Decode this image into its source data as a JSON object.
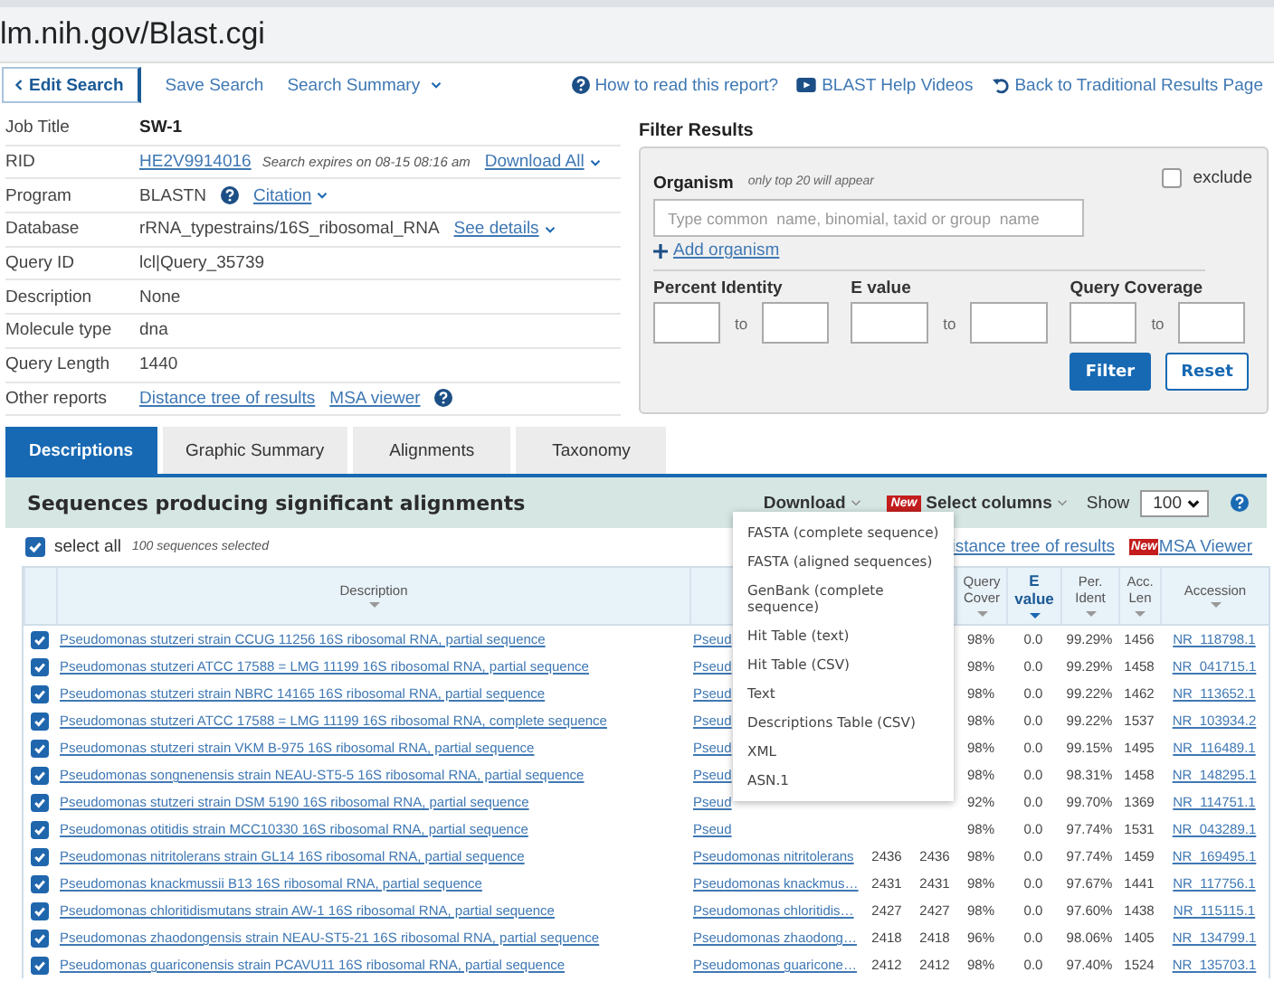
{
  "address_bar": {
    "url": "lm.nih.gov/Blast.cgi"
  },
  "nav": {
    "edit_search": "Edit Search",
    "links": [
      {
        "label": "Save Search",
        "menu": false
      },
      {
        "label": "Search Summary",
        "menu": true
      }
    ],
    "help_links": [
      {
        "kind": "help",
        "label": "How to read this report?"
      },
      {
        "kind": "video",
        "label": "BLAST Help Videos"
      },
      {
        "kind": "back",
        "label": "Back to Traditional Results Page"
      }
    ]
  },
  "info": [
    {
      "label": "Job Title",
      "parts": [
        {
          "kind": "bold",
          "text": "SW-1"
        }
      ]
    },
    {
      "label": "RID",
      "parts": [
        {
          "kind": "link",
          "text": "HE2V9914016",
          "menu": false
        },
        {
          "kind": "note",
          "text": "Search expires on 08-15 08:16 am"
        },
        {
          "kind": "link",
          "text": "Download All",
          "menu": true
        }
      ]
    },
    {
      "label": "Program",
      "parts": [
        {
          "kind": "text",
          "text": "BLASTN"
        },
        {
          "kind": "help"
        },
        {
          "kind": "link",
          "text": "Citation",
          "menu": true
        }
      ]
    },
    {
      "label": "Database",
      "parts": [
        {
          "kind": "text",
          "text": "rRNA_typestrains/16S_ribosomal_RNA"
        },
        {
          "kind": "link",
          "text": "See details",
          "menu": true
        }
      ]
    },
    {
      "label": "Query ID",
      "parts": [
        {
          "kind": "text",
          "text": "lcl|Query_35739"
        }
      ]
    },
    {
      "label": "Description",
      "parts": [
        {
          "kind": "text",
          "text": "None"
        }
      ]
    },
    {
      "label": "Molecule type",
      "parts": [
        {
          "kind": "text",
          "text": "dna"
        }
      ]
    },
    {
      "label": "Query Length",
      "parts": [
        {
          "kind": "text",
          "text": "1440"
        }
      ]
    },
    {
      "label": "Other reports",
      "parts": [
        {
          "kind": "link",
          "text": "Distance tree of results",
          "menu": false
        },
        {
          "kind": "link",
          "text": "MSA viewer",
          "menu": false
        },
        {
          "kind": "help"
        }
      ]
    }
  ],
  "filter": {
    "title": "Filter Results",
    "organism_label": "Organism",
    "organism_hint": "only top 20 will appear",
    "exclude": {
      "label": "exclude",
      "checked": false
    },
    "placeholder": "Type common  name, binomial, taxid or group  name",
    "add_organism": "Add organism",
    "ranges": [
      {
        "label": "Percent Identity",
        "to": "to"
      },
      {
        "label": "E value",
        "to": "to"
      },
      {
        "label": "Query Coverage",
        "to": "to"
      }
    ],
    "filter_button": "Filter",
    "reset_button": "Reset"
  },
  "tabs": [
    {
      "label": "Descriptions",
      "selected": true
    },
    {
      "label": "Graphic Summary",
      "selected": false
    },
    {
      "label": "Alignments",
      "selected": false
    },
    {
      "label": "Taxonomy",
      "selected": false
    }
  ],
  "results": {
    "title": "Sequences producing significant alignments",
    "download": "Download",
    "new_badge": "New",
    "select_columns": "Select columns",
    "show_label": "Show",
    "show_value": "100",
    "select_all": {
      "label": "select all",
      "checked": true
    },
    "selected_count": "100 sequences selected",
    "distance_tree": "istance tree of results",
    "msa_badge": "New",
    "msa_viewer": "MSA Viewer"
  },
  "download_menu": [
    "FASTA (complete sequence)",
    "FASTA (aligned sequences)",
    "GenBank (complete sequence)",
    "Hit Table (text)",
    "Hit Table (CSV)",
    "Text",
    "Descriptions Table (CSV)",
    "XML",
    "ASN.1"
  ],
  "table": {
    "columns": [
      {
        "label": "Description",
        "sorted": false
      },
      {
        "label": "Query Cover",
        "sorted": false
      },
      {
        "label": "E value",
        "sorted": true
      },
      {
        "label": "Per. Ident",
        "sorted": false
      },
      {
        "label": "Acc. Len",
        "sorted": false
      },
      {
        "label": "Accession",
        "sorted": false
      }
    ],
    "rows": [
      {
        "checked": true,
        "description": "Pseudomonas stutzeri strain CCUG 11256 16S ribosomal RNA, partial sequence",
        "sci_name": "Pseud",
        "query_cover": "98%",
        "e_value": "0.0",
        "per_ident": "99.29%",
        "acc_len": "1456",
        "accession": "NR_118798.1"
      },
      {
        "checked": true,
        "description": "Pseudomonas stutzeri ATCC 17588 = LMG 11199 16S ribosomal RNA, partial sequence",
        "sci_name": "Pseud",
        "query_cover": "98%",
        "e_value": "0.0",
        "per_ident": "99.29%",
        "acc_len": "1458",
        "accession": "NR_041715.1"
      },
      {
        "checked": true,
        "description": "Pseudomonas stutzeri strain NBRC 14165 16S ribosomal RNA, partial sequence",
        "sci_name": "Pseud",
        "query_cover": "98%",
        "e_value": "0.0",
        "per_ident": "99.22%",
        "acc_len": "1462",
        "accession": "NR_113652.1"
      },
      {
        "checked": true,
        "description": "Pseudomonas stutzeri ATCC 17588 = LMG 11199 16S ribosomal RNA, complete sequence",
        "sci_name": "Pseud",
        "query_cover": "98%",
        "e_value": "0.0",
        "per_ident": "99.22%",
        "acc_len": "1537",
        "accession": "NR_103934.2"
      },
      {
        "checked": true,
        "description": "Pseudomonas stutzeri strain VKM B-975 16S ribosomal RNA, partial sequence",
        "sci_name": "Pseud",
        "query_cover": "98%",
        "e_value": "0.0",
        "per_ident": "99.15%",
        "acc_len": "1495",
        "accession": "NR_116489.1"
      },
      {
        "checked": true,
        "description": "Pseudomonas songnenensis strain NEAU-ST5-5 16S ribosomal RNA, partial sequence",
        "sci_name": "Pseud",
        "query_cover": "98%",
        "e_value": "0.0",
        "per_ident": "98.31%",
        "acc_len": "1458",
        "accession": "NR_148295.1"
      },
      {
        "checked": true,
        "description": "Pseudomonas stutzeri strain DSM 5190 16S ribosomal RNA, partial sequence",
        "sci_name": "Pseud",
        "query_cover": "92%",
        "e_value": "0.0",
        "per_ident": "99.70%",
        "acc_len": "1369",
        "accession": "NR_114751.1"
      },
      {
        "checked": true,
        "description": "Pseudomonas otitidis strain MCC10330 16S ribosomal RNA, partial sequence",
        "sci_name": "Pseud",
        "query_cover": "98%",
        "e_value": "0.0",
        "per_ident": "97.74%",
        "acc_len": "1531",
        "accession": "NR_043289.1"
      },
      {
        "checked": true,
        "description": "Pseudomonas nitritolerans strain GL14 16S ribosomal RNA, partial sequence",
        "sci_name": "Pseudomonas nitritolerans",
        "max_score": "2436",
        "total_score": "2436",
        "query_cover": "98%",
        "e_value": "0.0",
        "per_ident": "97.74%",
        "acc_len": "1459",
        "accession": "NR_169495.1"
      },
      {
        "checked": true,
        "description": "Pseudomonas knackmussii B13 16S ribosomal RNA, partial sequence",
        "sci_name": "Pseudomonas knackmus…",
        "max_score": "2431",
        "total_score": "2431",
        "query_cover": "98%",
        "e_value": "0.0",
        "per_ident": "97.67%",
        "acc_len": "1441",
        "accession": "NR_117756.1"
      },
      {
        "checked": true,
        "description": "Pseudomonas chloritidismutans strain AW-1 16S ribosomal RNA, partial sequence",
        "sci_name": "Pseudomonas chloritidis…",
        "max_score": "2427",
        "total_score": "2427",
        "query_cover": "98%",
        "e_value": "0.0",
        "per_ident": "97.60%",
        "acc_len": "1438",
        "accession": "NR_115115.1"
      },
      {
        "checked": true,
        "description": "Pseudomonas zhaodongensis strain NEAU-ST5-21 16S ribosomal RNA, partial sequence",
        "sci_name": "Pseudomonas zhaodong…",
        "max_score": "2418",
        "total_score": "2418",
        "query_cover": "96%",
        "e_value": "0.0",
        "per_ident": "98.06%",
        "acc_len": "1405",
        "accession": "NR_134799.1"
      },
      {
        "checked": true,
        "description": "Pseudomonas guariconensis strain PCAVU11 16S ribosomal RNA, partial sequence",
        "sci_name": "Pseudomonas guaricone…",
        "max_score": "2412",
        "total_score": "2412",
        "query_cover": "98%",
        "e_value": "0.0",
        "per_ident": "97.40%",
        "acc_len": "1524",
        "accession": "NR_135703.1"
      }
    ]
  }
}
